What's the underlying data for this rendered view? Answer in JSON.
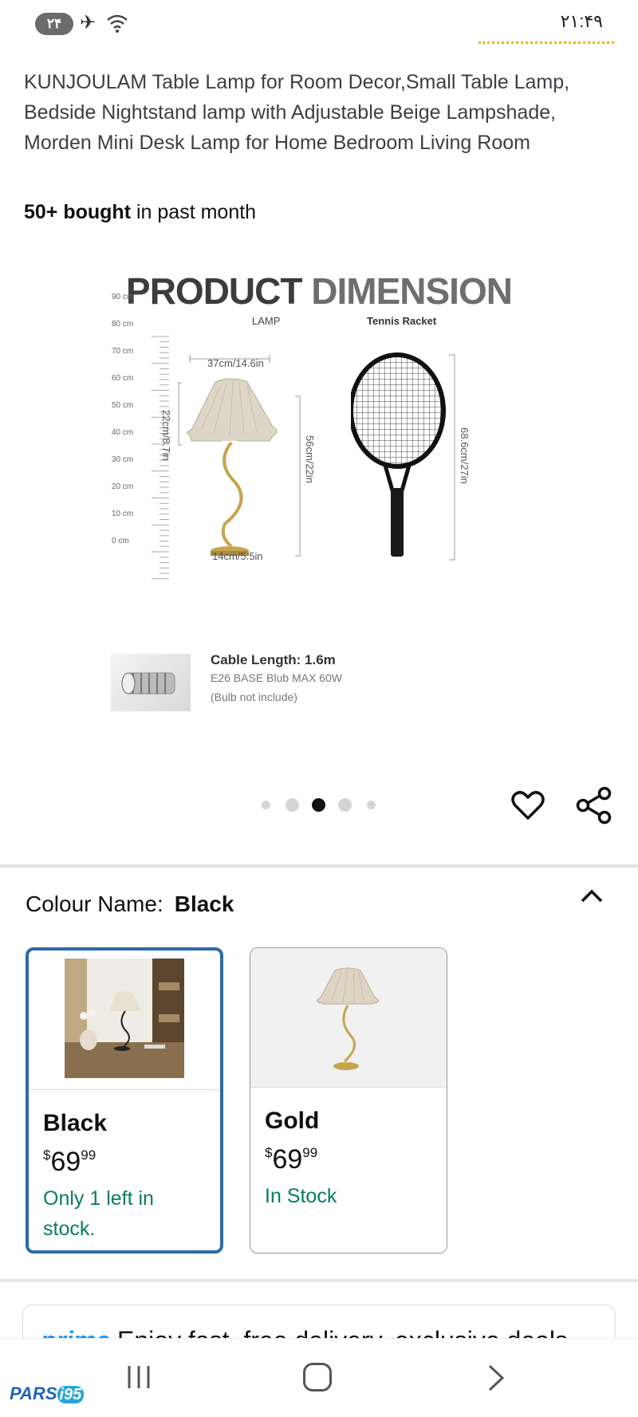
{
  "status_bar": {
    "badge": "۲۴",
    "time": "۲۱:۴۹",
    "icons": [
      "airplane-icon",
      "wifi-icon"
    ]
  },
  "product": {
    "title": "KUNJOULAM Table Lamp for Room Decor,Small Table Lamp, Bedside Nightstand lamp with Adjustable Beige Lampshade, Morden Mini Desk Lamp for Home Bedroom Living Room",
    "bought_bold": "50+ bought",
    "bought_rest": " in past month"
  },
  "image": {
    "heading_part1": "PRODUCT ",
    "heading_part2": "DIMENSION",
    "ruler_labels": [
      "90 cm",
      "80 cm",
      "70 cm",
      "60 cm",
      "50 cm",
      "40 cm",
      "30 cm",
      "20 cm",
      "10 cm",
      "0 cm"
    ],
    "lamp_label": "LAMP",
    "racket_label": "Tennis Racket",
    "shade_width": "37cm/14.6in",
    "shade_height": "22cm/8.7in",
    "lamp_height": "56cm/22in",
    "base_width": "14cm/5.5in",
    "racket_height": "68.6cm/27in",
    "cable_title": "Cable Length: 1.6m",
    "cable_sub": "E26 BASE Blub MAX 60W",
    "cable_note": "(Bulb not include)"
  },
  "carousel": {
    "total": 5,
    "active_index": 2
  },
  "colour": {
    "label": "Colour Name:",
    "value": "Black"
  },
  "swatches": [
    {
      "name": "Black",
      "currency": "$",
      "price_whole": "69",
      "price_frac": "99",
      "stock": "Only 1 left in stock.",
      "selected": true
    },
    {
      "name": "Gold",
      "currency": "$",
      "price_whole": "69",
      "price_frac": "99",
      "stock": "In Stock",
      "selected": false
    }
  ],
  "prime": {
    "brand": "prime",
    "text": " Enjoy fast, free delivery, exclusive deals"
  },
  "watermark": {
    "text": "PARS",
    "num": "i95"
  },
  "colors": {
    "accent_selected": "#2d6aa8",
    "stock_green": "#067d62",
    "prime_blue": "#1a98ff"
  }
}
